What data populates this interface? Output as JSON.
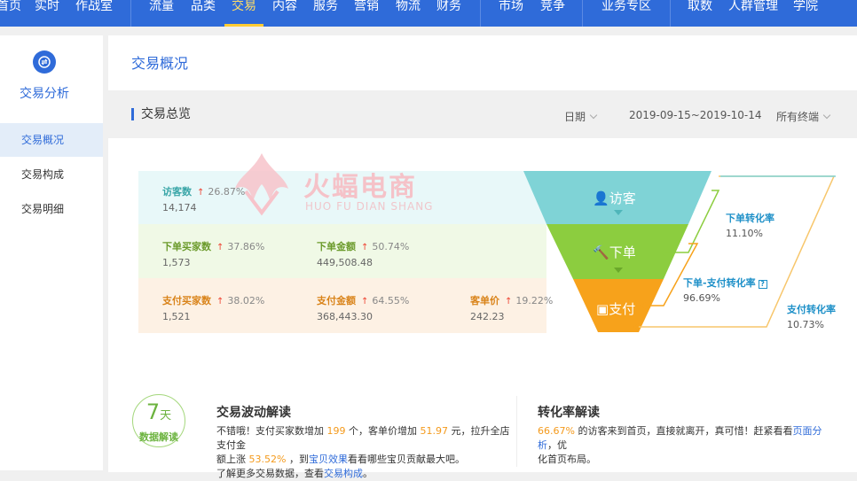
{
  "topnav": {
    "items": [
      "首页",
      "实时",
      "作战室",
      "流量",
      "品类",
      "交易",
      "内容",
      "服务",
      "营销",
      "物流",
      "财务",
      "市场",
      "竞争",
      "业务专区",
      "取数",
      "人群管理",
      "学院"
    ],
    "active": "交易"
  },
  "sidebar": {
    "title": "交易分析",
    "items": [
      "交易概况",
      "交易构成",
      "交易明细"
    ],
    "active": "交易概况"
  },
  "page_title": "交易概况",
  "section": {
    "title": "交易总览",
    "date_label": "日期",
    "date_range": "2019-09-15~2019-10-14",
    "terminal": "所有终端"
  },
  "metrics": {
    "visitors": {
      "label": "访客数",
      "pct": "26.87%",
      "value": "14,174"
    },
    "order_buyers": {
      "label": "下单买家数",
      "pct": "37.86%",
      "value": "1,573"
    },
    "order_amount": {
      "label": "下单金额",
      "pct": "50.74%",
      "value": "449,508.48"
    },
    "pay_buyers": {
      "label": "支付买家数",
      "pct": "38.02%",
      "value": "1,521"
    },
    "pay_amount": {
      "label": "支付金额",
      "pct": "64.55%",
      "value": "368,443.30"
    },
    "unit_price": {
      "label": "客单价",
      "pct": "19.22%",
      "value": "242.23"
    }
  },
  "funnel": {
    "visit": "访客",
    "order": "下单",
    "pay": "支付"
  },
  "conversions": {
    "order_rate": {
      "label": "下单转化率",
      "value": "11.10%"
    },
    "order_pay_rate": {
      "label": "下单-支付转化率",
      "value": "96.69%"
    },
    "pay_rate": {
      "label": "支付转化率",
      "value": "10.73%"
    }
  },
  "watermark": {
    "text": "火蝠电商",
    "sub": "HUO FU DIAN SHANG"
  },
  "analysis": {
    "seven_num": "7",
    "seven_unit": "天",
    "seven_label": "数据解读",
    "wave_title": "交易波动解读",
    "wave_1": "不错哦！支付买家数增加",
    "wave_n1": "199",
    "wave_2": "个，客单价增加",
    "wave_n2": "51.97",
    "wave_3": "元，拉升全店支付金",
    "wave_4": "额上涨",
    "wave_n3": "53.52%",
    "wave_5": "，到",
    "wave_link1": "宝贝效果",
    "wave_6": "看看哪些宝贝贡献最大吧。",
    "wave_7": "了解更多交易数据，查看",
    "wave_link2": "交易构成",
    "wave_8": "。",
    "conv_title": "转化率解读",
    "conv_n1": "66.67%",
    "conv_1": "的访客来到首页，直接就离开，真可惜！赶紧看看",
    "conv_link": "页面分析",
    "conv_2": "，优",
    "conv_3": "化首页布局。"
  },
  "colors": {
    "brand": "#2f6bd9",
    "visit": "#7fd3d6",
    "order": "#8ccd3f",
    "pay": "#f7a21b"
  }
}
